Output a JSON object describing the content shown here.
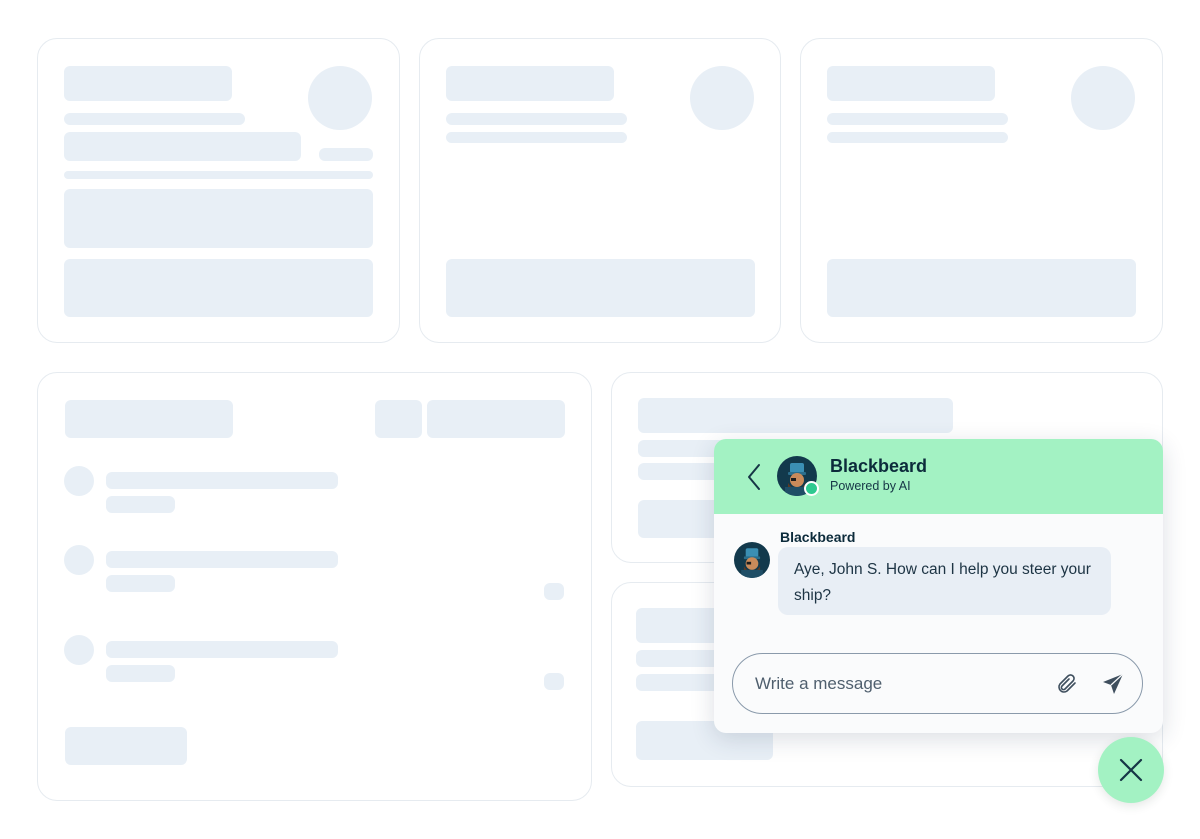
{
  "chat": {
    "header": {
      "bot_name": "Blackbeard",
      "subtitle": "Powered by AI",
      "background_color": "#a3f2c3",
      "back_icon": "chevron-left-icon",
      "status": "online"
    },
    "messages": [
      {
        "sender": "Blackbeard",
        "text": "Aye, John S. How can I help you steer your ship?",
        "avatar_icon": "pirate-avatar-icon"
      }
    ],
    "composer": {
      "placeholder": "Write a message",
      "attach_icon": "paperclip-icon",
      "send_icon": "send-icon"
    },
    "launcher": {
      "icon": "close-icon",
      "color": "#a3f2c3"
    }
  },
  "colors": {
    "skeleton": "#e8eff6",
    "card_border": "#e6ebf0",
    "text_dark": "#0c2b3b",
    "bubble": "#e8eef5"
  }
}
